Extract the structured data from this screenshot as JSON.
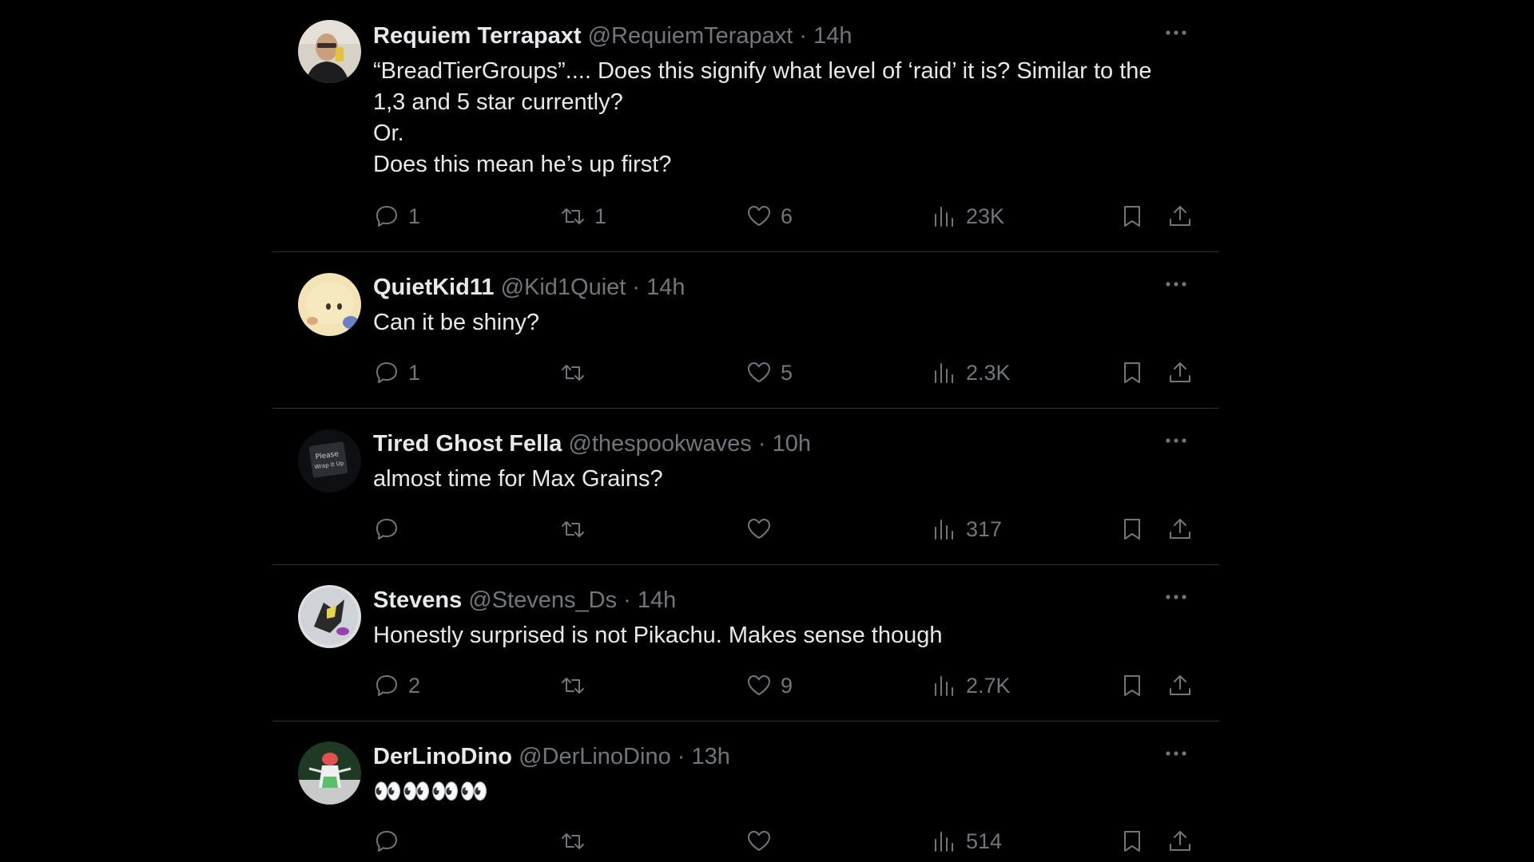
{
  "tweets": [
    {
      "name": "Requiem Terrapaxt",
      "handle": "@RequiemTerapaxt",
      "sep": "·",
      "time": "14h",
      "lines": [
        "“BreadTierGroups”.... Does this signify what level of ‘raid’ it is? Similar to the",
        "1,3 and 5 star currently?",
        "Or.",
        "Does this mean he’s up first?"
      ],
      "reply_count": "1",
      "retweet_count": "1",
      "like_count": "6",
      "view_count": "23K"
    },
    {
      "name": "QuietKid11",
      "handle": "@Kid1Quiet",
      "sep": "·",
      "time": "14h",
      "lines": [
        "Can it be shiny?"
      ],
      "reply_count": "1",
      "retweet_count": "",
      "like_count": "5",
      "view_count": "2.3K"
    },
    {
      "name": "Tired Ghost Fella",
      "handle": "@thespookwaves",
      "sep": "·",
      "time": "10h",
      "lines": [
        "almost time for Max Grains?"
      ],
      "reply_count": "",
      "retweet_count": "",
      "like_count": "",
      "view_count": "317",
      "avatar_sign_text": [
        "Please",
        "Wrap It Up"
      ]
    },
    {
      "name": "Stevens",
      "handle": "@Stevens_Ds",
      "sep": "·",
      "time": "14h",
      "lines": [
        "Honestly surprised is not Pikachu. Makes sense though"
      ],
      "reply_count": "2",
      "retweet_count": "",
      "like_count": "9",
      "view_count": "2.7K"
    },
    {
      "name": "DerLinoDino",
      "handle": "@DerLinoDino",
      "sep": "·",
      "time": "13h",
      "lines": [
        "👀👀👀👀"
      ],
      "reply_count": "",
      "retweet_count": "",
      "like_count": "",
      "view_count": "514"
    }
  ],
  "icons": {
    "reply": "reply-icon",
    "retweet": "retweet-icon",
    "like": "like-icon",
    "views": "views-icon",
    "bookmark": "bookmark-icon",
    "share": "share-icon",
    "more": "more-icon"
  },
  "colors": {
    "background": "#000000",
    "text": "#e7e9ea",
    "muted": "#71767b",
    "divider": "#2f3336"
  }
}
